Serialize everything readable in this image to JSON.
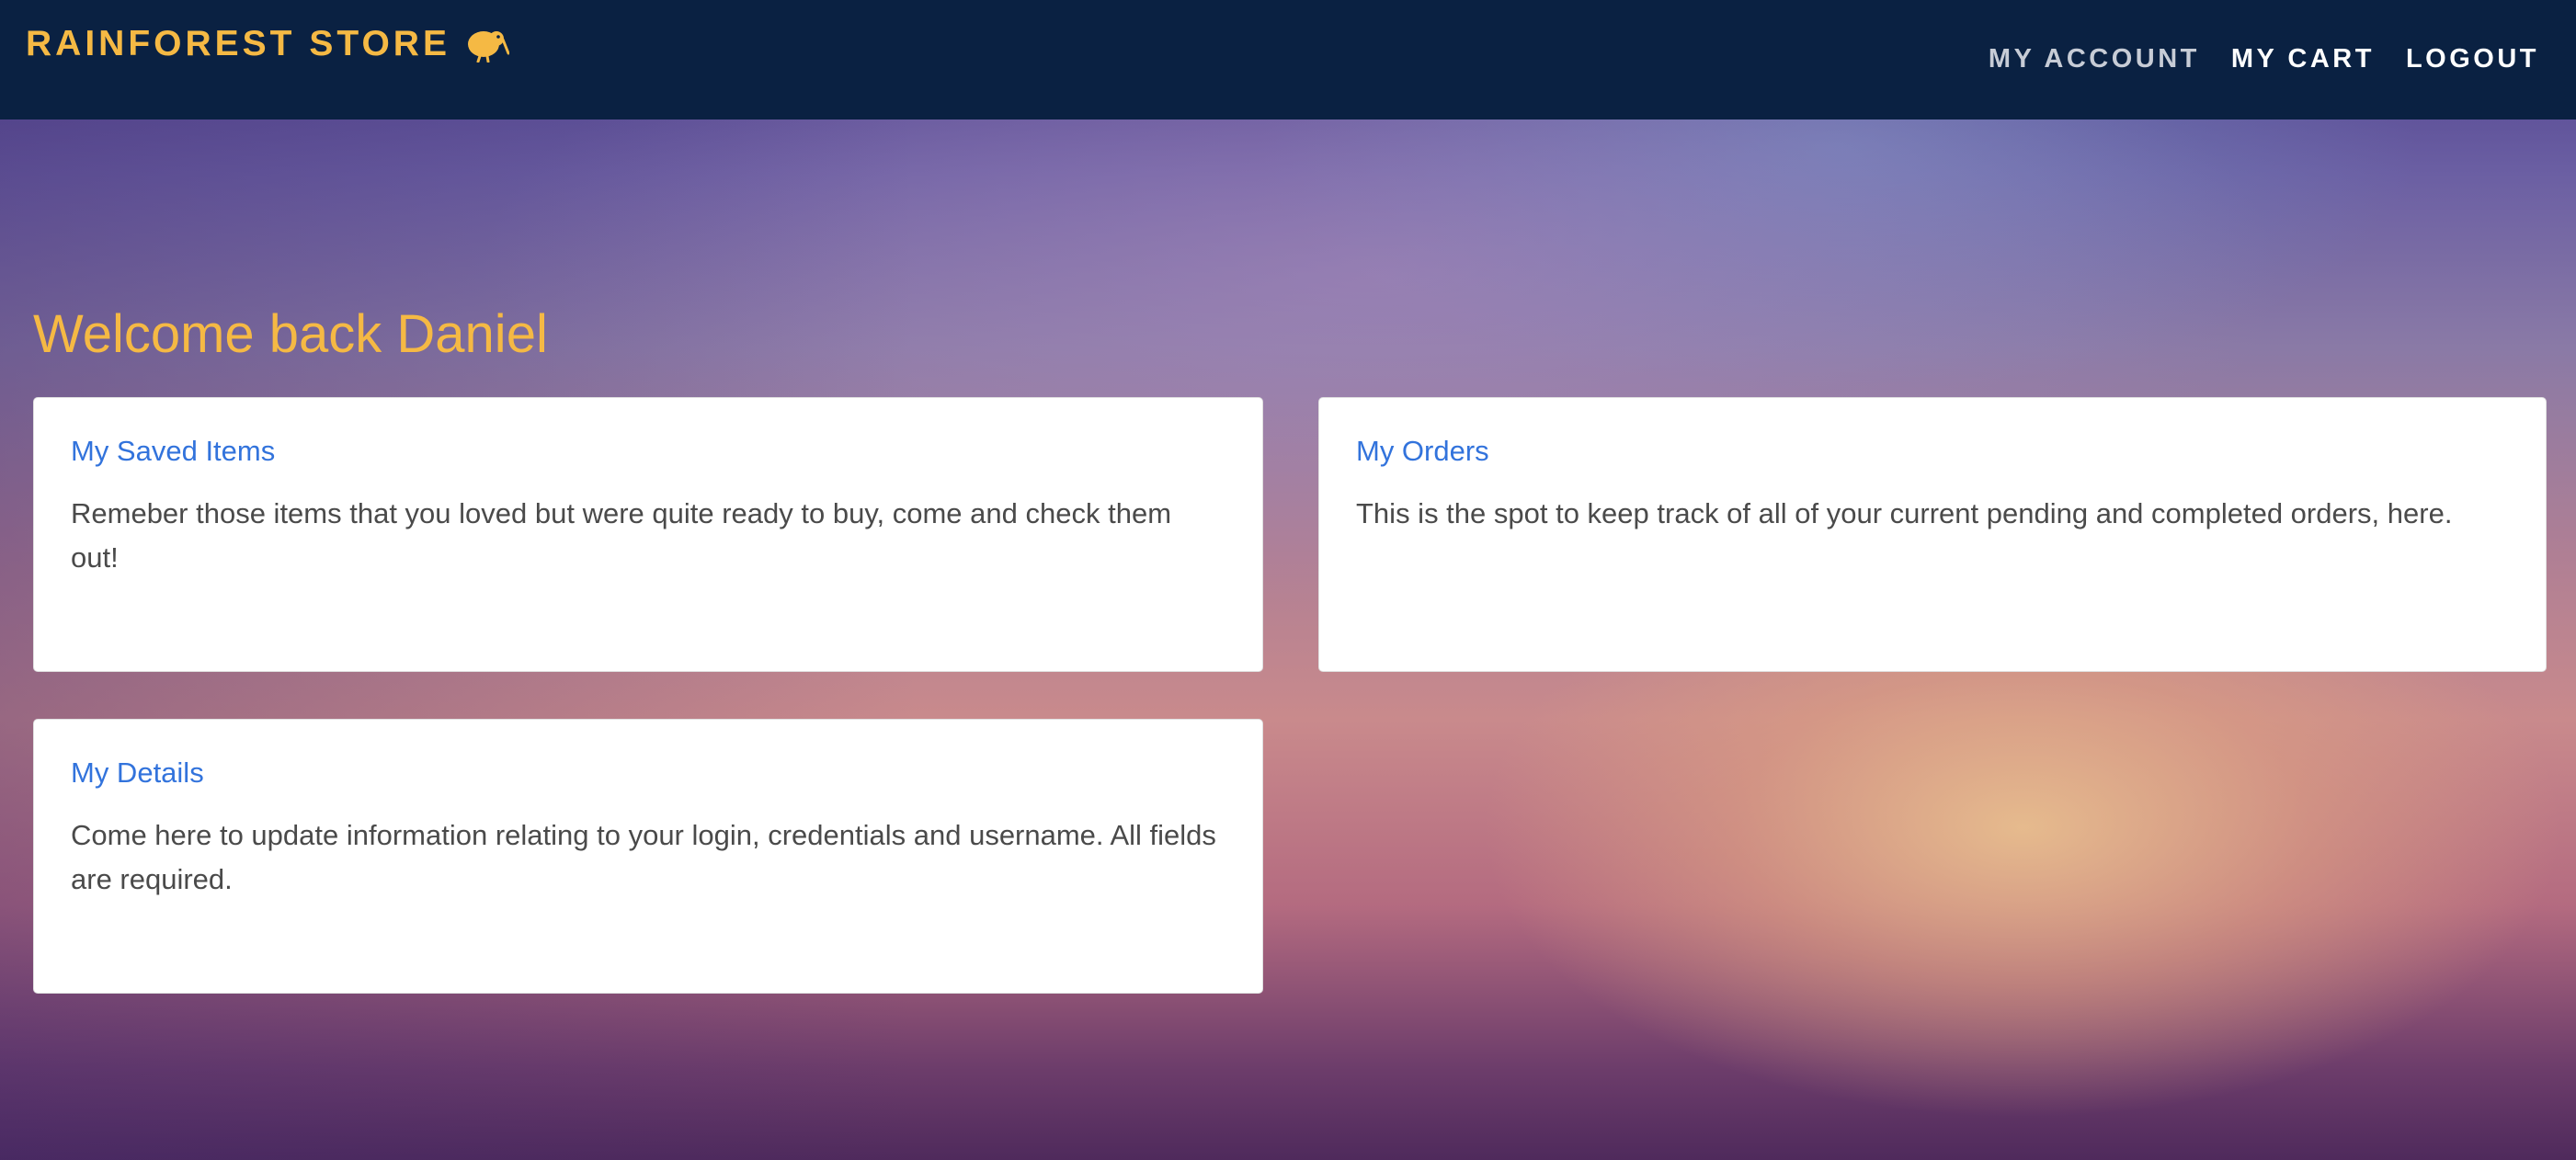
{
  "colors": {
    "navbar_bg": "#0a2142",
    "brand": "#f5b944",
    "link": "#3273dc",
    "text": "#4a4a4a"
  },
  "header": {
    "brand_label": "RAINFOREST STORE",
    "brand_icon": "kiwi-bird-icon",
    "nav": {
      "my_account": "MY ACCOUNT",
      "my_cart": "MY CART",
      "logout": "LOGOUT"
    }
  },
  "main": {
    "welcome": "Welcome back Daniel",
    "cards": [
      {
        "title": "My Saved Items",
        "text": "Remeber those items that you loved but were quite ready to buy, come and check them out!"
      },
      {
        "title": "My Orders",
        "text": "This is the spot to keep track of all of your current pending and completed orders, here."
      },
      {
        "title": "My Details",
        "text": "Come here to update information relating to your login, credentials and username. All fields are required."
      }
    ]
  }
}
